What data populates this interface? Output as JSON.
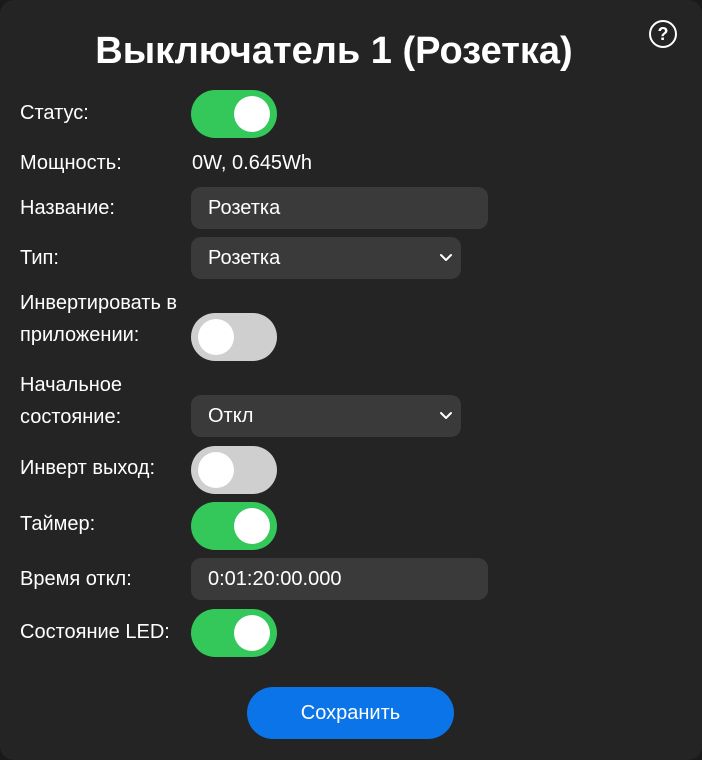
{
  "dialog": {
    "title": "Выключатель 1 (Розетка)",
    "help_label": "?"
  },
  "fields": {
    "status": {
      "label": "Статус:",
      "on": true
    },
    "power": {
      "label": "Мощность:",
      "value": "0W, 0.645Wh"
    },
    "name": {
      "label": "Название:",
      "value": "Розетка"
    },
    "type": {
      "label": "Тип:",
      "selected": "Розетка"
    },
    "invert_app": {
      "label_line1": "Инвертировать в",
      "label_line2": "приложении:",
      "on": false
    },
    "initial_state": {
      "label_line1": "Начальное",
      "label_line2": "состояние:",
      "selected": "Откл"
    },
    "invert_output": {
      "label": "Инверт выход:",
      "on": false
    },
    "timer": {
      "label": "Таймер:",
      "on": true
    },
    "off_time": {
      "label": "Время откл:",
      "value": "0:01:20:00.000"
    },
    "led_state": {
      "label": "Состояние LED:",
      "on": true
    }
  },
  "actions": {
    "save_label": "Сохранить"
  },
  "colors": {
    "toggle_on": "#34c759",
    "toggle_off": "#cfcfcf",
    "accent": "#0a74e8",
    "background": "#242424",
    "field_bg": "#3a3a3a"
  },
  "icons": {
    "help": "help-icon",
    "select_arrow": "chevron-down-icon"
  }
}
